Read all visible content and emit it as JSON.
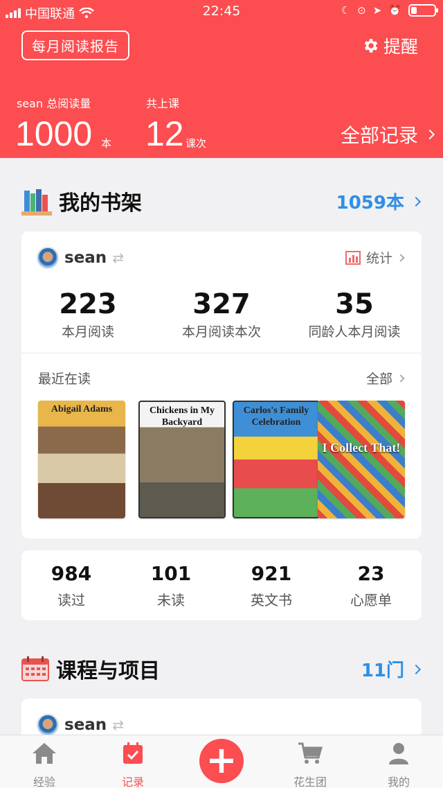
{
  "status_bar": {
    "carrier": "中国联通",
    "time": "22:45"
  },
  "header": {
    "report_button": "每月阅读报告",
    "remind_label": "提醒",
    "total_label": "sean 总阅读量",
    "total_value": "1000",
    "total_unit": "本",
    "lessons_label": "共上课",
    "lessons_value": "12",
    "lessons_unit": "课次",
    "all_records": "全部记录"
  },
  "bookshelf": {
    "title": "我的书架",
    "count_link": "1059本",
    "user": "sean",
    "stats_link": "统计",
    "stats": [
      {
        "value": "223",
        "label": "本月阅读"
      },
      {
        "value": "327",
        "label": "本月阅读本次"
      },
      {
        "value": "35",
        "label": "同龄人本月阅读"
      }
    ],
    "recent_label": "最近在读",
    "all_label": "全部",
    "books": [
      {
        "title": "Abigail Adams"
      },
      {
        "title": "Chickens in My Backyard"
      },
      {
        "title": "Carlos's Family Celebration"
      },
      {
        "title": "I Collect That!"
      }
    ]
  },
  "shelf_counts": [
    {
      "value": "984",
      "label": "读过"
    },
    {
      "value": "101",
      "label": "未读"
    },
    {
      "value": "921",
      "label": "英文书"
    },
    {
      "value": "23",
      "label": "心愿单"
    }
  ],
  "courses": {
    "title": "课程与项目",
    "count_link": "11门",
    "user": "sean"
  },
  "tabs": [
    {
      "label": "经验"
    },
    {
      "label": "记录"
    },
    {
      "label": "花生团"
    },
    {
      "label": "我的"
    }
  ],
  "colors": {
    "brand": "#fc4d50",
    "link": "#2e8fe6"
  }
}
